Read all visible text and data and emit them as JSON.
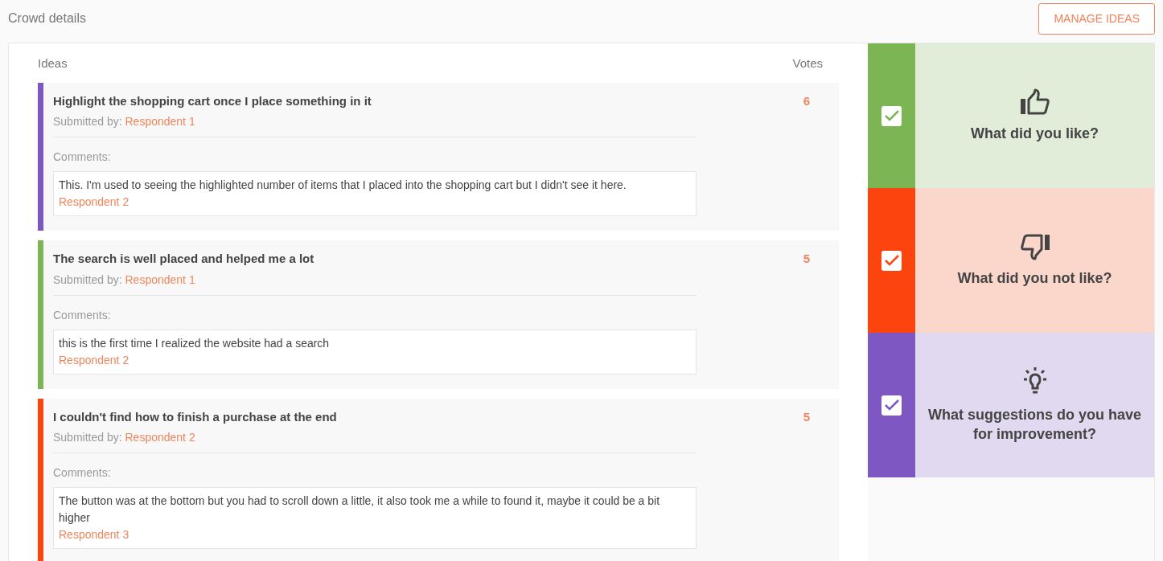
{
  "header": {
    "title": "Crowd details",
    "button": "MANAGE IDEAS"
  },
  "columns": {
    "ideas": "Ideas",
    "votes": "Votes"
  },
  "ideas": [
    {
      "title": "Highlight the shopping cart once I place something in it",
      "submitted_label": "Submitted by:",
      "submitter": "Respondent 1",
      "votes": "6",
      "color": "#7e57c2",
      "comments_label": "Comments:",
      "comments": [
        {
          "text": "This. I'm used to seeing the highlighted number of items that I placed into the shopping cart but I didn't see it here.",
          "author": "Respondent 2"
        }
      ]
    },
    {
      "title": "The search is well placed and helped me a lot",
      "submitted_label": "Submitted by:",
      "submitter": "Respondent 1",
      "votes": "5",
      "color": "#7cb554",
      "comments_label": "Comments:",
      "comments": [
        {
          "text": "this is the first time I realized the website had a search",
          "author": "Respondent 2"
        }
      ]
    },
    {
      "title": "I couldn't find how to finish a purchase at the end",
      "submitted_label": "Submitted by:",
      "submitter": "Respondent 2",
      "votes": "5",
      "color": "#fc440f",
      "comments_label": "Comments:",
      "comments": [
        {
          "text": "The button was at the bottom but you had to scroll down a little, it also took me a while to found it, maybe it could be a bit higher",
          "author": "Respondent 3"
        }
      ]
    }
  ],
  "categories": [
    {
      "kind": "like",
      "label": "What did you like?",
      "checked": true,
      "color": "#7cb554"
    },
    {
      "kind": "dislike",
      "label": "What did you not like?",
      "checked": true,
      "color": "#fc440f"
    },
    {
      "kind": "suggestion",
      "label": "What suggestions do you have for improvement?",
      "checked": true,
      "color": "#7e57c2"
    }
  ]
}
